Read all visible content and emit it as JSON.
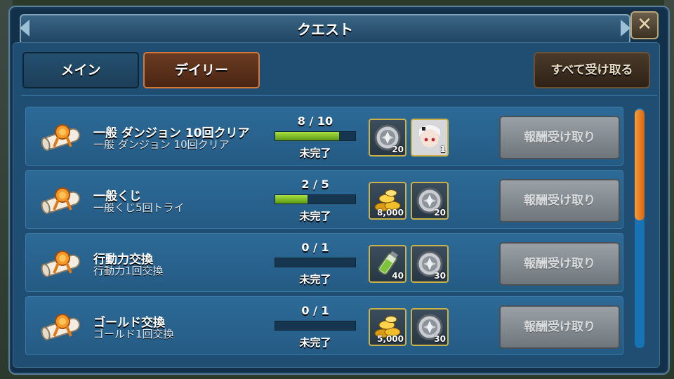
{
  "header": {
    "title": "クエスト",
    "close_icon": "close-x-icon"
  },
  "tabs": {
    "main": "メイン",
    "daily": "デイリー"
  },
  "claim_all": "すべて受け取る",
  "quests": [
    {
      "title": "一般 ダンジョン 10回クリア",
      "desc": "一般 ダンジョン 10回クリア",
      "progress_text": "8 / 10",
      "progress": 0.8,
      "status": "未完了",
      "rewards": [
        {
          "icon": "medal-icon",
          "count": "20"
        },
        {
          "icon": "character-icon",
          "count": "1"
        }
      ],
      "button": "報酬受け取り"
    },
    {
      "title": "一般くじ",
      "desc": "一般くじ5回トライ",
      "progress_text": "2 / 5",
      "progress": 0.4,
      "status": "未完了",
      "rewards": [
        {
          "icon": "gold-coins-icon",
          "count": "8,000"
        },
        {
          "icon": "medal-icon",
          "count": "20"
        }
      ],
      "button": "報酬受け取り"
    },
    {
      "title": "行動力交換",
      "desc": "行動力1回交換",
      "progress_text": "0 / 1",
      "progress": 0,
      "status": "未完了",
      "rewards": [
        {
          "icon": "potion-icon",
          "count": "40"
        },
        {
          "icon": "medal-icon",
          "count": "30"
        }
      ],
      "button": "報酬受け取り"
    },
    {
      "title": "ゴールド交換",
      "desc": "ゴールド1回交換",
      "progress_text": "0 / 1",
      "progress": 0,
      "status": "未完了",
      "rewards": [
        {
          "icon": "gold-coins-icon",
          "count": "5,000"
        },
        {
          "icon": "medal-icon",
          "count": "30"
        }
      ],
      "button": "報酬受け取り"
    }
  ],
  "scroll_position": 0.47
}
